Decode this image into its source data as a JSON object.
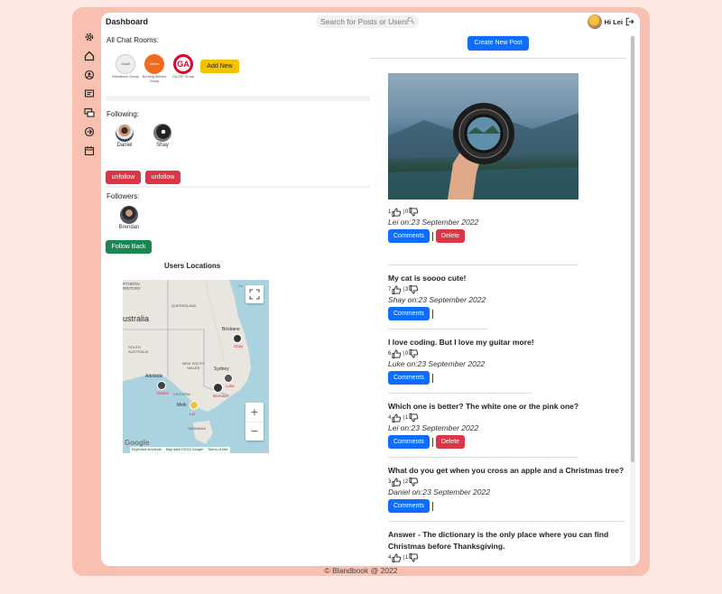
{
  "app": {
    "title": "Dashboard",
    "search_placeholder": "Search for Posts or Users",
    "greeting": "Hi Lei",
    "footer": "© Blandbook @ 2022"
  },
  "sidebar": {
    "items": [
      "settings-icon",
      "home-icon",
      "profile-icon",
      "posts-icon",
      "chat-icon",
      "explore-icon",
      "calendar-icon"
    ]
  },
  "chat_rooms": {
    "heading": "All Chat Rooms:",
    "rooms": [
      {
        "name": "Blandbook Group",
        "logo_text": "Gaslit"
      },
      {
        "name": "Burning Airlines Group",
        "logo_text": "airlines"
      },
      {
        "name": "GA SEI Group",
        "logo_text": "GA"
      }
    ],
    "add_label": "Add New"
  },
  "following": {
    "heading": "Following:",
    "people": [
      "Daniel",
      "Shay"
    ],
    "unfollow_label": "unfollow"
  },
  "followers": {
    "heading": "Followers:",
    "people": [
      "Brendan"
    ],
    "follow_back_label": "Follow Back"
  },
  "map": {
    "title": "Users Locations",
    "labels": {
      "northern_territory": "RTHERN\nRRITORY",
      "queensland": "QUEENSLAND",
      "australia": "ustralia",
      "south_australia": "SOUTH\nAUSTRALIA",
      "nsw": "NEW SOUTH\nWALES",
      "brisbane": "Brisbane",
      "sydney": "Sydney",
      "adelaide": "Adelaide",
      "victoria": "VICTORIA",
      "melbourne": "Melb",
      "tasmania": "TASMANIA",
      "coral_sea": "Co"
    },
    "pins": {
      "shay": "Shay",
      "luke": "Luke",
      "daniel": "Daniel",
      "lei": "Lei",
      "brendan": "Brendan"
    },
    "zoom_in": "+",
    "zoom_out": "−",
    "attribution": [
      "Keyboard shortcuts",
      "Map data ©2022 Google",
      "Terms of Use"
    ],
    "google": "Google"
  },
  "feed": {
    "create_label": "Create New Post",
    "comments_label": "Comments",
    "delete_label": "Delete",
    "posts": [
      {
        "title": "",
        "likes": "1",
        "dislikes": "0",
        "meta": "Lei on:23 September 2022",
        "deletable": true
      },
      {
        "title": "My cat is soooo cute!",
        "likes": "7",
        "dislikes": "3",
        "meta": "Shay on:23 September 2022",
        "deletable": false
      },
      {
        "title": "I love coding. But I love my guitar more!",
        "likes": "6",
        "dislikes": "0",
        "meta": "Luke on:23 September 2022",
        "deletable": false
      },
      {
        "title": "Which one is better? The white one or the pink one?",
        "likes": "4",
        "dislikes": "1",
        "meta": "Lei on:23 September 2022",
        "deletable": true
      },
      {
        "title": "What do you get when you cross an apple and a Christmas tree?",
        "likes": "3",
        "dislikes": "2",
        "meta": "Daniel on:23 September 2022",
        "deletable": false
      },
      {
        "title": "Answer - The dictionary is the only place where you can find Christmas before Thanksgiving.",
        "likes": "4",
        "dislikes": "1",
        "meta": "",
        "deletable": false
      }
    ]
  },
  "colors": {
    "page_bg": "#fde8e3",
    "frame": "#f8c0b0",
    "primary": "#0d6efd",
    "danger": "#dc3545",
    "success": "#198754",
    "warning": "#f5c200"
  }
}
